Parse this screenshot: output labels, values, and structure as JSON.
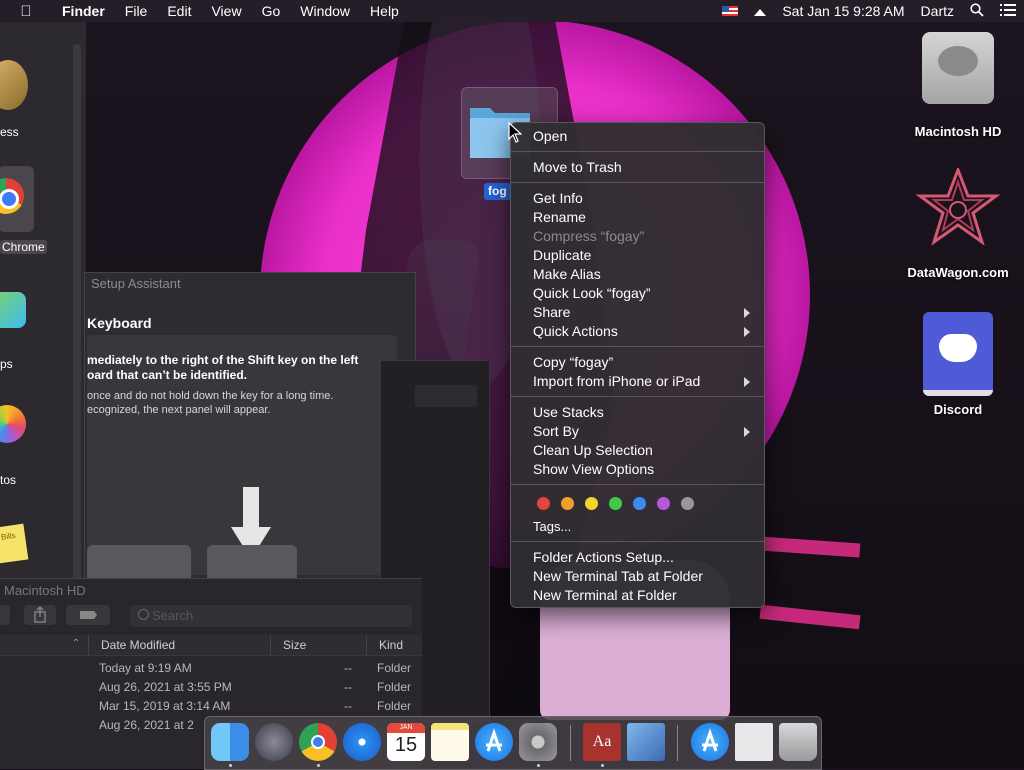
{
  "menubar": {
    "app_name": "Finder",
    "menus": [
      "File",
      "Edit",
      "View",
      "Go",
      "Window",
      "Help"
    ],
    "clock": "Sat Jan 15  9:28 AM",
    "user": "Dartz",
    "icons": [
      "apple-icon",
      "flag-icon",
      "eject-icon",
      "search-icon",
      "list-icon"
    ]
  },
  "left_window": {
    "labels": [
      "ess",
      "Chrome",
      "ps",
      "tos"
    ],
    "sticky_text": "Bills"
  },
  "setup_assistant": {
    "title": "Setup Assistant",
    "heading": "Keyboard",
    "instruction_bold": "mediately to the right of the Shift key on the left\noard that can’t be identified.",
    "instruction": "once and do not hold down the key for a long time.\necognized, the next panel will appear."
  },
  "finder_list": {
    "title": "Macintosh HD",
    "search_placeholder": "Search",
    "columns": [
      "Date Modified",
      "Size",
      "Kind"
    ],
    "rows": [
      {
        "date": "Today at 9:19 AM",
        "size": "--",
        "kind": "Folder"
      },
      {
        "date": "Aug 26, 2021 at 3:55 PM",
        "size": "--",
        "kind": "Folder"
      },
      {
        "date": "Mar 15, 2019 at 3:14 AM",
        "size": "--",
        "kind": "Folder"
      },
      {
        "date": "Aug 26, 2021 at 2",
        "size": "",
        "kind": ""
      }
    ]
  },
  "desktop": {
    "folder_label": "fog",
    "items": [
      {
        "label": "Macintosh HD",
        "icon": "hard-drive-icon"
      },
      {
        "label": "DataWagon.com",
        "icon": "datawagon-icon"
      },
      {
        "label": "Discord",
        "icon": "discord-icon"
      }
    ]
  },
  "context_menu": {
    "open": "Open",
    "move_to_trash": "Move to Trash",
    "get_info": "Get Info",
    "rename": "Rename",
    "compress": "Compress “fogay”",
    "duplicate": "Duplicate",
    "make_alias": "Make Alias",
    "quick_look": "Quick Look “fogay”",
    "share": "Share",
    "quick_actions": "Quick Actions",
    "copy": "Copy “fogay”",
    "import_iphone": "Import from iPhone or iPad",
    "use_stacks": "Use Stacks",
    "sort_by": "Sort By",
    "clean_up": "Clean Up Selection",
    "show_view_options": "Show View Options",
    "tags": "Tags...",
    "tag_colors": [
      "#e2453c",
      "#f0a02a",
      "#f5d42a",
      "#3fc84a",
      "#3a8cf0",
      "#b45ad8",
      "#9a979c"
    ],
    "folder_actions": "Folder Actions Setup...",
    "new_terminal_tab": "New Terminal Tab at Folder",
    "new_terminal": "New Terminal at Folder"
  },
  "dock": {
    "calendar_month": "JAN",
    "calendar_day": "15",
    "dictionary_glyph": "Aa",
    "apps": [
      "finder-icon",
      "launchpad-icon",
      "chrome-icon",
      "safari-icon",
      "calendar-icon",
      "notes-icon",
      "app-store-icon",
      "system-preferences-icon",
      "dictionary-icon",
      "preview-icon",
      "downloads-icon",
      "document-icon",
      "trash-icon"
    ]
  }
}
